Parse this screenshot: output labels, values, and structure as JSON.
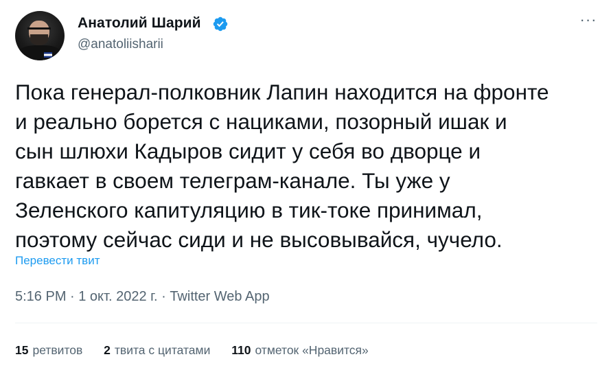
{
  "user": {
    "display_name": "Анатолий Шарий",
    "handle": "@anatoliisharii",
    "verified_icon": "verified-badge-icon",
    "avatar_icon": "avatar-photo"
  },
  "more_icon": "more-horizontal-icon",
  "tweet": {
    "lines": [
      "Пока генерал-полковник Лапин находится на фронте",
      "и реально борется с нациками, позорный ишак и",
      "сын шлюхи Кадыров сидит у себя во дворце и",
      "гавкает в своем телеграм-канале. Ты уже у",
      "Зеленского капитуляцию в тик-токе принимал,",
      "поэтому сейчас сиди и не высовывайся, чучело."
    ],
    "translate_label": "Перевести твит",
    "meta": "5:16 PM · 1 окт. 2022 г. · Twitter Web App"
  },
  "stats": {
    "retweets_count": "15",
    "retweets_label": "ретвитов",
    "quotes_count": "2",
    "quotes_label": "твита с цитатами",
    "likes_count": "110",
    "likes_label": "отметок «Нравится»"
  },
  "colors": {
    "accent": "#1d9bf0",
    "text_primary": "#0f1419",
    "text_secondary": "#536471",
    "divider": "#eff3f4"
  }
}
